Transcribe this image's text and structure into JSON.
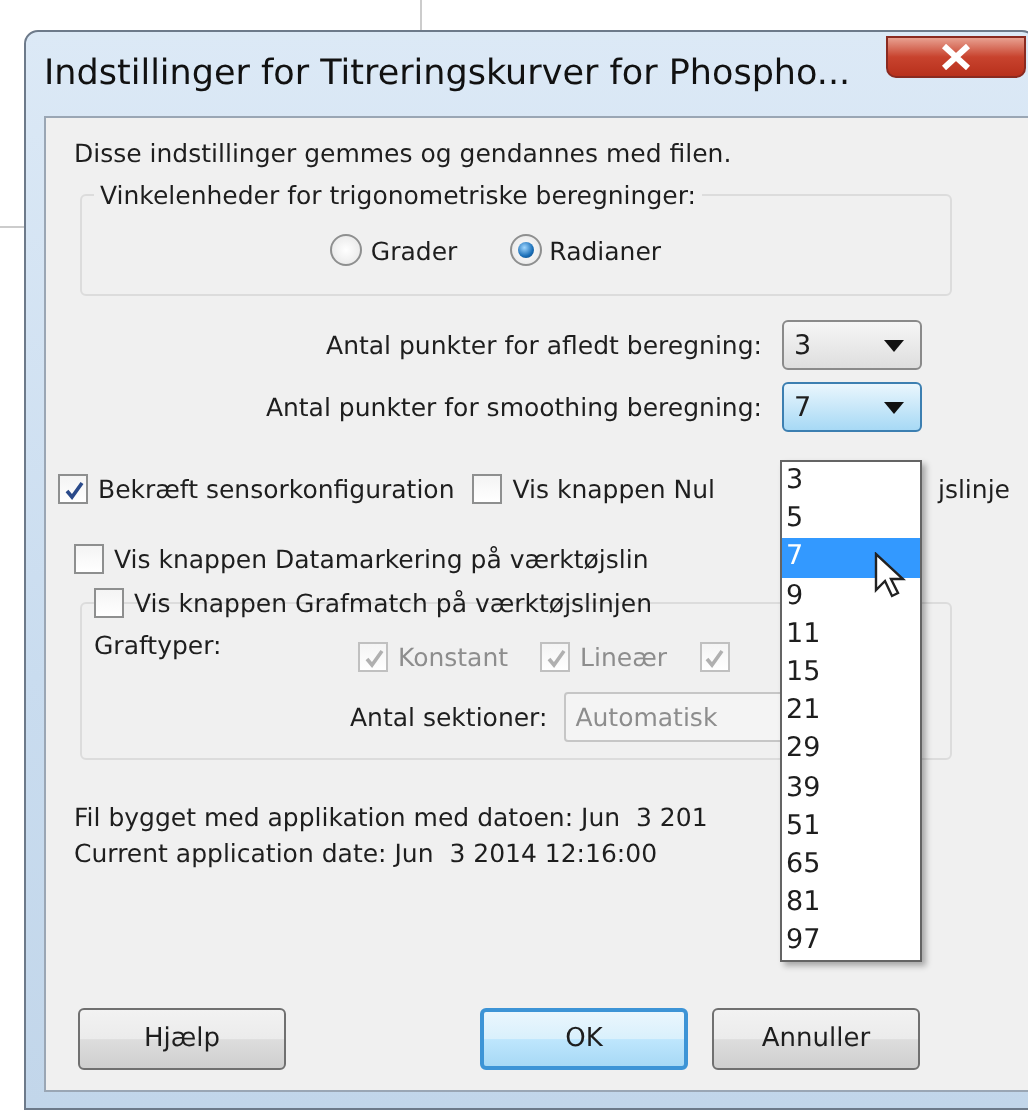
{
  "window": {
    "title": "Indstillinger for Titreringskurver for Phospho..."
  },
  "intro": "Disse indstillinger gemmes og gendannes med filen.",
  "angle_group": {
    "label": "Vinkelenheder for trigonometriske beregninger:",
    "options": [
      {
        "label": "Grader",
        "selected": false
      },
      {
        "label": "Radianer",
        "selected": true
      }
    ]
  },
  "point_settings": [
    {
      "label": "Antal punkter for afledt beregning:",
      "value": "3",
      "focused": false
    },
    {
      "label": "Antal punkter for smoothing beregning:",
      "value": "7",
      "focused": true
    }
  ],
  "checkbox_row": [
    {
      "label": "Bekræft sensorkonfiguration",
      "checked": true
    },
    {
      "label": "Vis knappen Nul",
      "checked": false
    }
  ],
  "covered_text_tail": "jslinje",
  "datamarkering": {
    "label": "Vis knappen Datamarkering på værktøjslin",
    "checked": false
  },
  "grafmatch": {
    "label": "Vis knappen Grafmatch på værktøjslinjen",
    "checked": false,
    "graph_types_label": "Graftyper:",
    "graph_types": [
      {
        "label": "Konstant",
        "checked": true,
        "disabled": true
      },
      {
        "label": "Lineær",
        "checked": true,
        "disabled": true
      },
      {
        "checked": true,
        "disabled": true
      }
    ],
    "sections_label": "Antal sektioner:",
    "sections_value": "Automatisk",
    "sections_disabled": true
  },
  "info": [
    "Fil bygget med applikation med datoen: Jun  3 201",
    "Current application date: Jun  3 2014 12:16:00"
  ],
  "dropdown_list": {
    "items": [
      {
        "label": "3",
        "selected": false
      },
      {
        "label": "5",
        "selected": false
      },
      {
        "label": "7",
        "selected": true
      },
      {
        "label": "9",
        "selected": false
      },
      {
        "label": "11",
        "selected": false
      },
      {
        "label": "15",
        "selected": false
      },
      {
        "label": "21",
        "selected": false
      },
      {
        "label": "29",
        "selected": false
      },
      {
        "label": "39",
        "selected": false
      },
      {
        "label": "51",
        "selected": false
      },
      {
        "label": "65",
        "selected": false
      },
      {
        "label": "81",
        "selected": false
      },
      {
        "label": "97",
        "selected": false
      }
    ]
  },
  "buttons": [
    {
      "label": "Hjælp",
      "default": false
    },
    {
      "label": "OK",
      "default": true
    },
    {
      "label": "Annuller",
      "default": false
    }
  ]
}
